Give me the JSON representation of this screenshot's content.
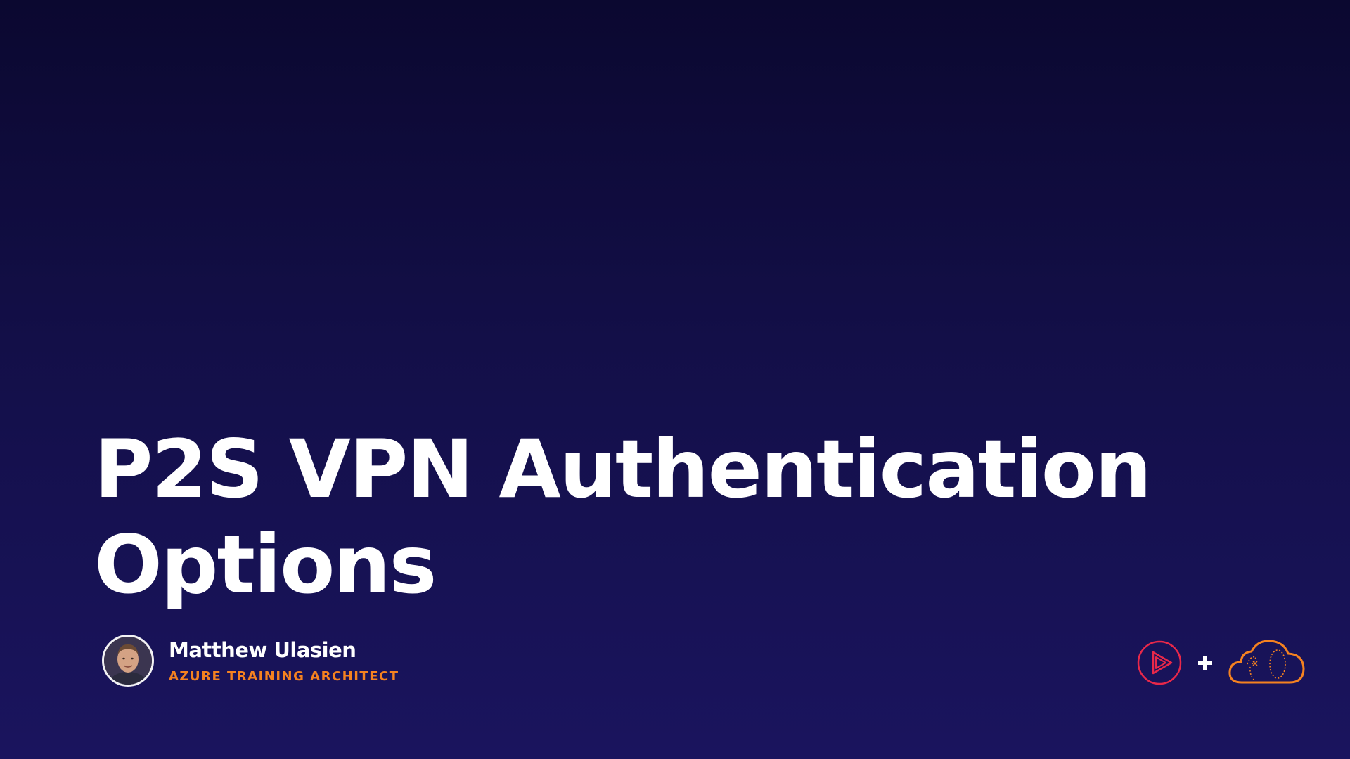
{
  "slide": {
    "title_line_1": "P2S VPN Authentication",
    "title_line_2": "Options"
  },
  "presenter": {
    "name": "Matthew Ulasien",
    "role": "AZURE TRAINING ARCHITECT"
  },
  "icons": {
    "avatar": "presenter-avatar",
    "logo_left": "pluralsight-play-icon",
    "separator": "plus-icon",
    "logo_right": "acloudguru-cloud-icon"
  },
  "colors": {
    "background_top": "#0b0830",
    "background_bottom": "#1a145e",
    "title_text": "#ffffff",
    "role_accent": "#f58220",
    "pluralsight_red": "#e8284a",
    "cloud_orange": "#f58220"
  }
}
